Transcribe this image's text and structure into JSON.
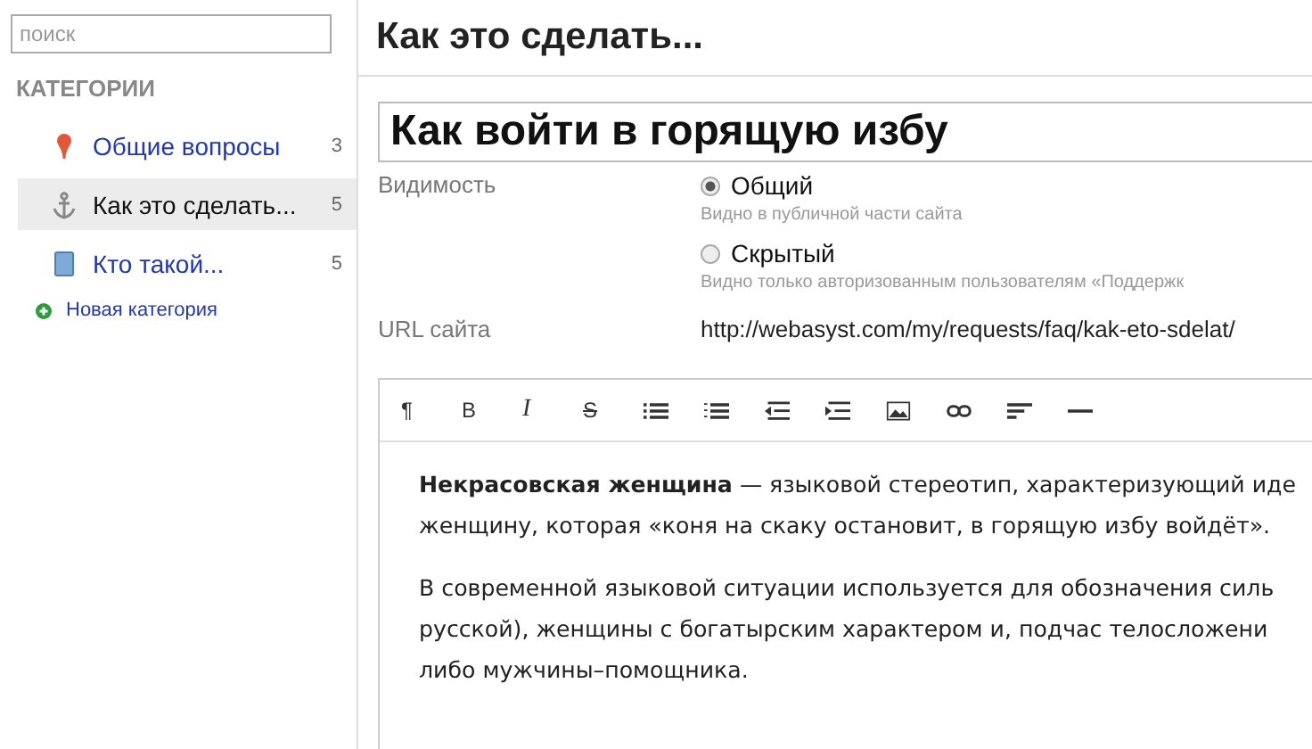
{
  "sidebar": {
    "search": {
      "placeholder": "поиск"
    },
    "heading": "КАТЕГОРИИ",
    "categories": [
      {
        "kind": "pin",
        "label": "Общие вопросы",
        "count": "3",
        "selected": false
      },
      {
        "kind": "anchor",
        "label": "Как это сделать...",
        "count": "5",
        "selected": true
      },
      {
        "kind": "book",
        "label": "Кто такой...",
        "count": "5",
        "selected": false
      }
    ],
    "add_link": "Новая категория"
  },
  "page": {
    "heading": "Как это сделать...",
    "title_input": {
      "value": "Как войти в горящую избу"
    },
    "visibility": {
      "label": "Видимость",
      "options": [
        {
          "label": "Общий",
          "hint": "Видно в публичной части сайта",
          "selected": true
        },
        {
          "label": "Скрытый",
          "hint": "Видно только авторизованным пользователям «Поддержк",
          "selected": false
        }
      ]
    },
    "url": {
      "label": "URL сайта",
      "value": "http://webasyst.com/my/requests/faq/kak-eto-sdelat/"
    },
    "editor": {
      "toolbar": [
        {
          "kind": "text",
          "glyph": "¶"
        },
        {
          "kind": "text",
          "glyph": "B"
        },
        {
          "kind": "italic",
          "glyph": "I"
        },
        {
          "kind": "strike",
          "glyph": "S"
        },
        {
          "kind": "ul"
        },
        {
          "kind": "ol"
        },
        {
          "kind": "outdent"
        },
        {
          "kind": "indent"
        },
        {
          "kind": "image"
        },
        {
          "kind": "link"
        },
        {
          "kind": "align"
        },
        {
          "kind": "hr"
        }
      ],
      "paragraphs": [
        "**Некрасовская женщина** — языковой стереотип, характеризующий иде\nженщину, которая «коня на скаку остановит, в горящую избу войдёт».",
        "В современной языковой ситуации используется для обозначения силь\nрусской), женщины с богатырским характером и, подчас телосложени\nлибо мужчины–помощника."
      ]
    }
  }
}
